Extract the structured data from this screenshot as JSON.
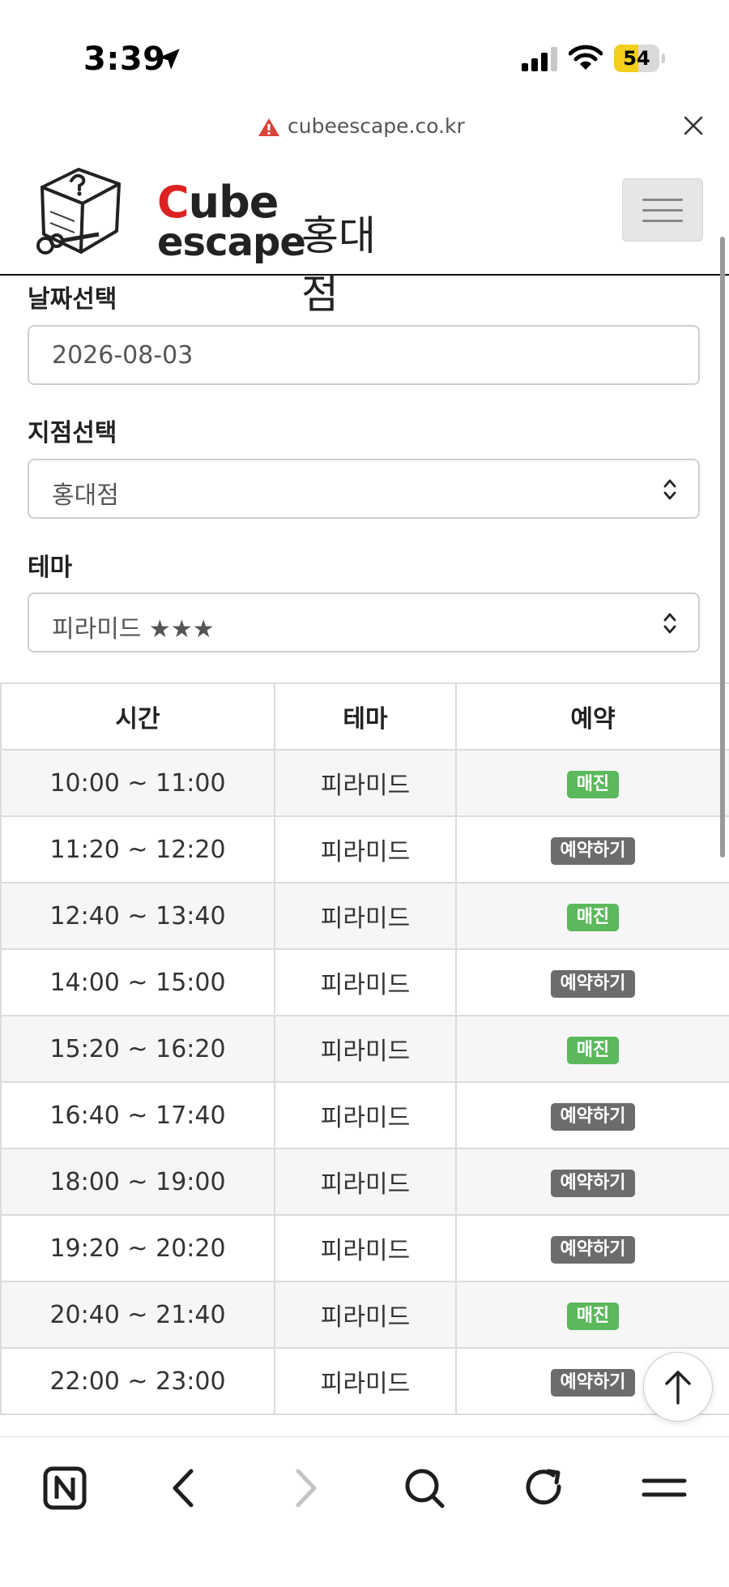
{
  "status_bar": {
    "time": "3:39",
    "battery": "54",
    "battery_level": 0.54,
    "icons": [
      "location-arrow-icon",
      "cellular-signal-icon",
      "wifi-icon",
      "battery-icon"
    ]
  },
  "url_bar": {
    "url": "cubeescape.co.kr",
    "warning_icon": "warning-triangle-icon",
    "close_icon": "close-icon"
  },
  "site_header": {
    "logo_line1_accent": "C",
    "logo_line1_rest": "ube",
    "logo_line2": "escape",
    "branch_name": "홍대점",
    "menu_icon": "hamburger-icon"
  },
  "form": {
    "date_label": "날짜선택",
    "date_value": "2026-08-03",
    "branch_label": "지점선택",
    "branch_value": "홍대점",
    "theme_label": "테마",
    "theme_value": "피라미드 ★★★"
  },
  "table": {
    "headers": [
      "시간",
      "테마",
      "예약"
    ],
    "rows": [
      {
        "time": "10:00 ~ 11:00",
        "theme": "피라미드",
        "status": "매진"
      },
      {
        "time": "11:20 ~ 12:20",
        "theme": "피라미드",
        "status": "예약하기"
      },
      {
        "time": "12:40 ~ 13:40",
        "theme": "피라미드",
        "status": "매진"
      },
      {
        "time": "14:00 ~ 15:00",
        "theme": "피라미드",
        "status": "예약하기"
      },
      {
        "time": "15:20 ~ 16:20",
        "theme": "피라미드",
        "status": "매진"
      },
      {
        "time": "16:40 ~ 17:40",
        "theme": "피라미드",
        "status": "예약하기"
      },
      {
        "time": "18:00 ~ 19:00",
        "theme": "피라미드",
        "status": "예약하기"
      },
      {
        "time": "19:20 ~ 20:20",
        "theme": "피라미드",
        "status": "예약하기"
      },
      {
        "time": "20:40 ~ 21:40",
        "theme": "피라미드",
        "status": "매진"
      },
      {
        "time": "22:00 ~ 23:00",
        "theme": "피라미드",
        "status": "예약하기"
      }
    ]
  },
  "colors": {
    "sold_out_badge": "#5cb85c",
    "reserve_badge": "#6c6c6c",
    "battery": "#f3ce1a",
    "logo_accent": "#dd2222"
  },
  "toolbar": {
    "icons": [
      "naver-home-icon",
      "back-icon",
      "forward-icon",
      "search-icon",
      "reload-icon",
      "menu-icon"
    ]
  },
  "scroll_top_icon": "arrow-up-icon"
}
